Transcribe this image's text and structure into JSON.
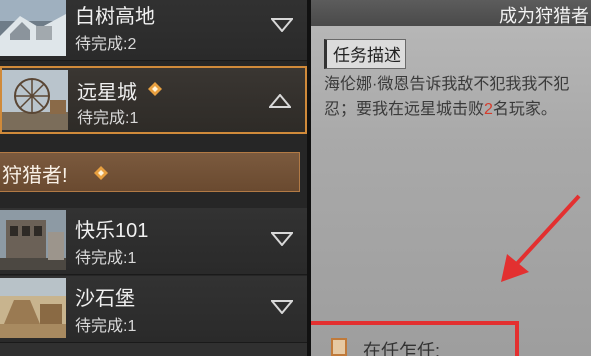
{
  "locations": [
    {
      "name": "白树高地",
      "pending": "待完成:2",
      "expanded": false,
      "has_marker": false
    },
    {
      "name": "远星城",
      "pending": "待完成:1",
      "expanded": true,
      "has_marker": true
    },
    {
      "name": "快乐101",
      "pending": "待完成:1",
      "expanded": false,
      "has_marker": false
    },
    {
      "name": "沙石堡",
      "pending": "待完成:1",
      "expanded": false,
      "has_marker": false
    }
  ],
  "active_task": {
    "label": "狩猎者!"
  },
  "detail": {
    "title": "成为狩猎者",
    "section_label": "任务描述",
    "desc_line1": "海伦娜·微恩告诉我敌不犯我我不犯",
    "desc_line2_prefix": "忍；要我在远星城击败",
    "desc_line2_count": "2",
    "desc_line2_suffix": "名玩家。",
    "accept_label": "在任乍任:"
  },
  "colors": {
    "accent": "#d08a3a",
    "highlight_red": "#d43c2c",
    "annotation_red": "#e33030"
  }
}
